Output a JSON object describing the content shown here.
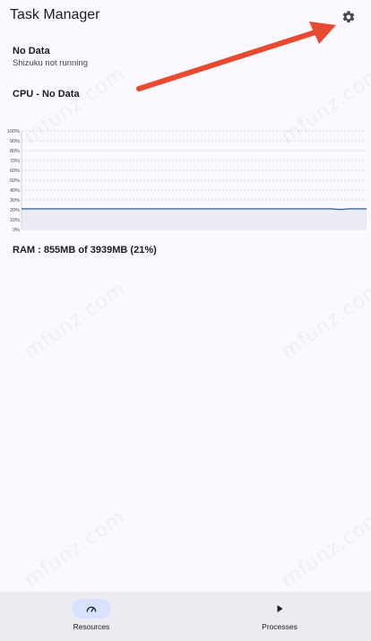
{
  "app_bar": {
    "title": "Task Manager",
    "settings_icon": "gear-icon"
  },
  "status": {
    "title": "No Data",
    "subtitle": "Shizuku not running"
  },
  "cpu": {
    "label": "CPU - No Data"
  },
  "chart_data": {
    "type": "area",
    "ylabels": [
      "100%",
      "90%",
      "80%",
      "70%",
      "60%",
      "50%",
      "40%",
      "30%",
      "20%",
      "10%",
      "0%"
    ],
    "ylim": [
      0,
      100
    ],
    "grid": true,
    "series": [
      {
        "values": [
          21,
          21,
          21,
          21,
          21,
          21,
          21,
          21,
          21,
          21,
          21,
          21,
          21,
          21,
          21,
          21,
          21,
          21,
          21,
          21,
          21,
          21,
          21,
          21,
          21,
          21,
          21,
          21,
          21,
          21,
          21,
          21,
          21,
          21,
          21,
          21,
          21,
          21,
          21,
          21,
          21,
          21,
          21,
          21,
          21,
          21,
          21,
          21,
          21,
          21,
          21,
          21,
          21,
          21,
          20.5,
          20.5,
          21,
          21,
          21,
          21
        ]
      }
    ],
    "line_color": "#3a5a8c",
    "fill_color": "#e3e6f0"
  },
  "ram": {
    "label": "RAM : 855MB of 3939MB (21%)"
  },
  "watermark": "mfunz.com",
  "annotation_color": "#e8492f",
  "bottom_nav": {
    "items": [
      {
        "label": "Resources",
        "icon": "speedometer-icon",
        "active": true
      },
      {
        "label": "Processes",
        "icon": "play-icon",
        "active": false
      }
    ]
  }
}
